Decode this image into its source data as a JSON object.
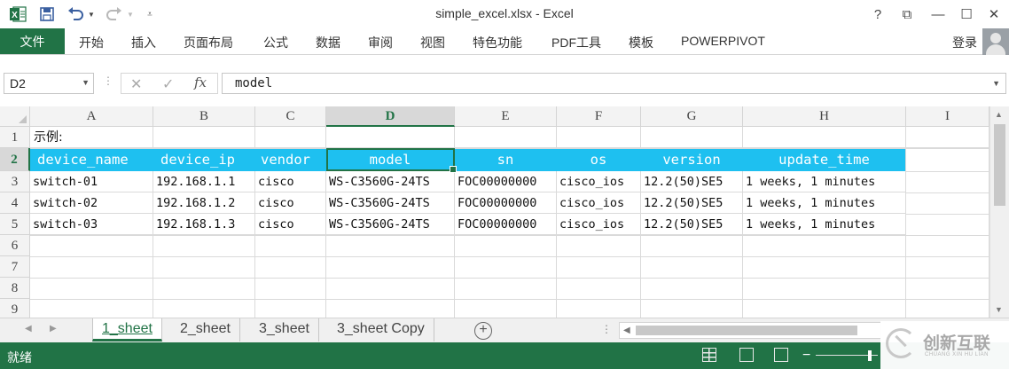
{
  "app": {
    "title": "simple_excel.xlsx - Excel",
    "accent": "#217346",
    "header_fill": "#1ec0f0"
  },
  "window_controls": {
    "help": "?",
    "ribbon_display": "⧉",
    "minimize": "—",
    "maximize": "☐",
    "close": "✕"
  },
  "ribbon": {
    "file_tab": "文件",
    "tabs": [
      "开始",
      "插入",
      "页面布局",
      "公式",
      "数据",
      "审阅",
      "视图",
      "特色功能",
      "PDF工具",
      "模板",
      "POWERPIVOT"
    ],
    "login": "登录"
  },
  "formula_bar": {
    "name_box": "D2",
    "fx": "fx",
    "value": "model"
  },
  "columns": [
    "A",
    "B",
    "C",
    "D",
    "E",
    "F",
    "G",
    "H",
    "I"
  ],
  "selected_column": "D",
  "rows": [
    "1",
    "2",
    "3",
    "4",
    "5",
    "6",
    "7",
    "8",
    "9"
  ],
  "sheet": {
    "a1": "示例:",
    "header": [
      "device_name",
      "device_ip",
      "vendor",
      "model",
      "sn",
      "os",
      "version",
      "update_time"
    ],
    "data": [
      [
        "switch-01",
        "192.168.1.1",
        "cisco",
        "WS-C3560G-24TS",
        "FOC00000000",
        "cisco_ios",
        "12.2(50)SE5",
        "1 weeks, 1 minutes"
      ],
      [
        "switch-02",
        "192.168.1.2",
        "cisco",
        "WS-C3560G-24TS",
        "FOC00000000",
        "cisco_ios",
        "12.2(50)SE5",
        "1 weeks, 1 minutes"
      ],
      [
        "switch-03",
        "192.168.1.3",
        "cisco",
        "WS-C3560G-24TS",
        "FOC00000000",
        "cisco_ios",
        "12.2(50)SE5",
        "1 weeks, 1 minutes"
      ]
    ]
  },
  "sheet_tabs": [
    "1_sheet",
    "2_sheet",
    "3_sheet",
    "3_sheet Copy"
  ],
  "active_sheet": "1_sheet",
  "status": {
    "ready": "就绪"
  },
  "watermark": {
    "text": "创新互联",
    "sub": "CHUANG XIN HU LIAN"
  }
}
